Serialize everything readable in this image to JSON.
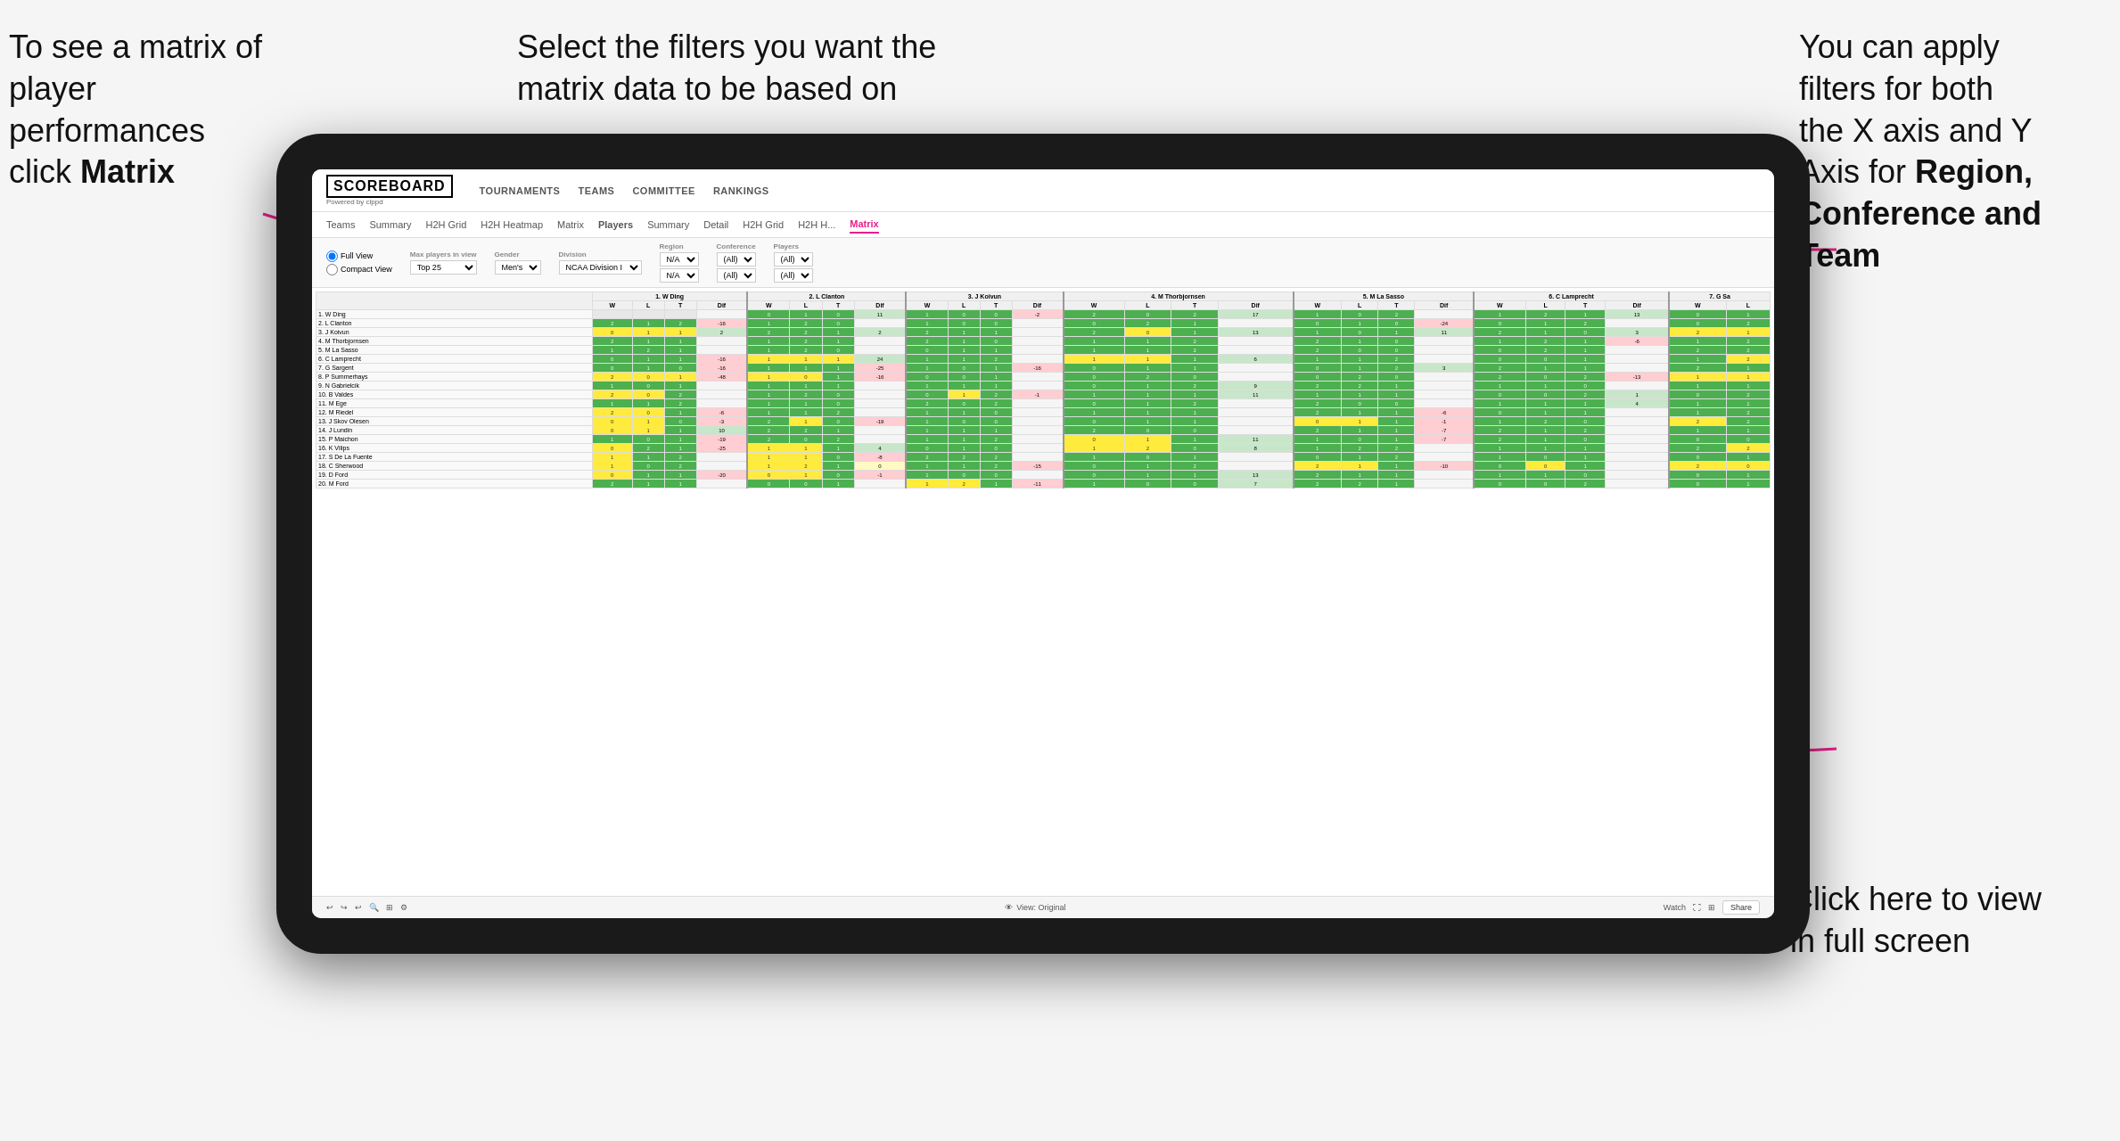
{
  "annotations": {
    "top_left": {
      "line1": "To see a matrix of",
      "line2": "player performances",
      "line3_plain": "click ",
      "line3_bold": "Matrix"
    },
    "top_center": {
      "text": "Select the filters you want the matrix data to be based on"
    },
    "top_right": {
      "line1": "You  can apply",
      "line2": "filters for both",
      "line3": "the X axis and Y",
      "line4_plain": "Axis for ",
      "line4_bold": "Region,",
      "line5_bold": "Conference and",
      "line6_bold": "Team"
    },
    "bottom_right": {
      "line1": "Click here to view",
      "line2": "in full screen"
    }
  },
  "scoreboard": {
    "logo": "SCOREBOARD",
    "powered_by": "Powered by clppd",
    "nav": {
      "tournaments": "TOURNAMENTS",
      "teams": "TEAMS",
      "committee": "COMMITTEE",
      "rankings": "RANKINGS"
    }
  },
  "sub_nav": {
    "items": [
      {
        "label": "Teams",
        "active": false
      },
      {
        "label": "Summary",
        "active": false
      },
      {
        "label": "H2H Grid",
        "active": false
      },
      {
        "label": "H2H Heatmap",
        "active": false
      },
      {
        "label": "Matrix",
        "active": false
      },
      {
        "label": "Players",
        "active": false
      },
      {
        "label": "Summary",
        "active": false
      },
      {
        "label": "Detail",
        "active": false
      },
      {
        "label": "H2H Grid",
        "active": false
      },
      {
        "label": "H2H H...",
        "active": false
      },
      {
        "label": "Matrix",
        "active": true
      }
    ]
  },
  "filters": {
    "view": {
      "full": "Full View",
      "compact": "Compact View"
    },
    "max_players": {
      "label": "Max players in view",
      "value": "Top 25"
    },
    "gender": {
      "label": "Gender",
      "value": "Men's"
    },
    "division": {
      "label": "Division",
      "value": "NCAA Division I"
    },
    "region": {
      "label": "Region",
      "value": "N/A",
      "value2": "N/A"
    },
    "conference": {
      "label": "Conference",
      "value": "(All)",
      "value2": "(All)"
    },
    "players": {
      "label": "Players",
      "value": "(All)",
      "value2": "(All)"
    }
  },
  "matrix": {
    "column_headers": [
      "1. W Ding",
      "2. L Clanton",
      "3. J Koivun",
      "4. M Thorbjornsen",
      "5. M La Sasso",
      "6. C Lamprecht",
      "7. G Sa"
    ],
    "sub_headers": [
      "W",
      "L",
      "T",
      "Dif"
    ],
    "players": [
      "1. W Ding",
      "2. L Clanton",
      "3. J Koivun",
      "4. M Thorbjornsen",
      "5. M La Sasso",
      "6. C Lamprecht",
      "7. G Sargent",
      "8. P Summerhays",
      "9. N Gabrielcik",
      "10. B Valdes",
      "11. M Ege",
      "12. M Riedel",
      "13. J Skov Olesen",
      "14. J Lundin",
      "15. P Maichon",
      "16. K Vilips",
      "17. S De La Fuente",
      "18. C Sherwood",
      "19. D Ford",
      "20. M Ford"
    ]
  },
  "bottom_bar": {
    "view_label": "View: Original",
    "watch_label": "Watch",
    "share_label": "Share"
  }
}
